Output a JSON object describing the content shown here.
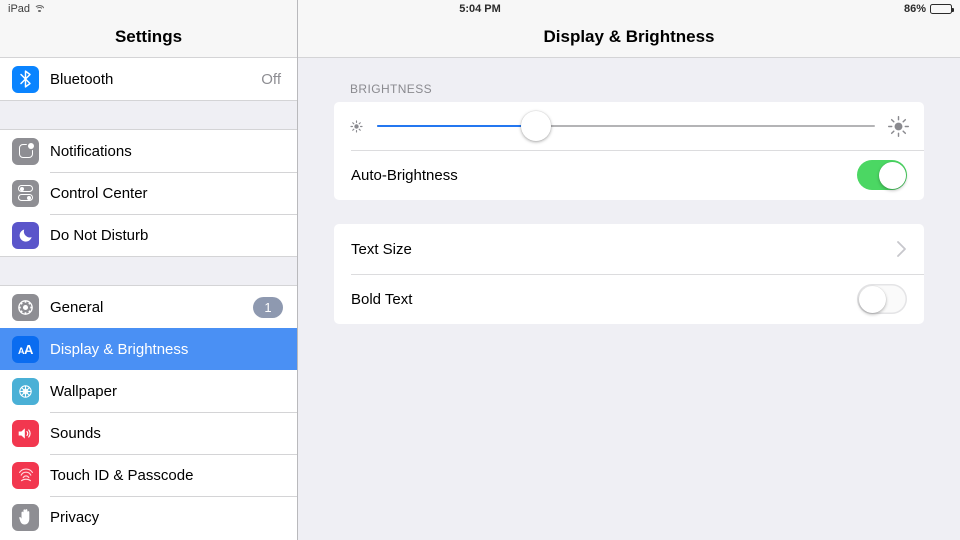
{
  "statusbar": {
    "device_label": "iPad",
    "wifi_icon": "wifi-icon",
    "time": "5:04 PM",
    "battery_percent": "86%",
    "battery_icon": "battery-icon"
  },
  "sidebar": {
    "title": "Settings",
    "groups": [
      {
        "items": [
          {
            "label": "Bluetooth",
            "value": "Off",
            "icon": "bluetooth-icon",
            "icon_color": "#0a84ff",
            "selected": false
          }
        ]
      },
      {
        "items": [
          {
            "label": "Notifications",
            "value": "",
            "icon": "notifications-icon",
            "icon_color": "#8e8e93",
            "selected": false
          },
          {
            "label": "Control Center",
            "value": "",
            "icon": "control-center-icon",
            "icon_color": "#8e8e93",
            "selected": false
          },
          {
            "label": "Do Not Disturb",
            "value": "",
            "icon": "moon-icon",
            "icon_color": "#5a55ca",
            "selected": false
          }
        ]
      },
      {
        "items": [
          {
            "label": "General",
            "value": "",
            "badge": "1",
            "icon": "gear-icon",
            "icon_color": "#8e8e93",
            "selected": false
          },
          {
            "label": "Display & Brightness",
            "value": "",
            "icon": "text-size-aa-icon",
            "icon_color": "#0a6cf0",
            "selected": true
          },
          {
            "label": "Wallpaper",
            "value": "",
            "icon": "flower-icon",
            "icon_color": "#4ab0d6",
            "selected": false
          },
          {
            "label": "Sounds",
            "value": "",
            "icon": "speaker-icon",
            "icon_color": "#f2374f",
            "selected": false
          },
          {
            "label": "Touch ID & Passcode",
            "value": "",
            "icon": "fingerprint-icon",
            "icon_color": "#f2374f",
            "selected": false
          },
          {
            "label": "Privacy",
            "value": "",
            "icon": "hand-icon",
            "icon_color": "#8e8e93",
            "selected": false
          }
        ]
      }
    ]
  },
  "content": {
    "title": "Display & Brightness",
    "brightness_section": {
      "header": "BRIGHTNESS",
      "slider": {
        "name": "brightness-slider",
        "value_percent": 32,
        "low_icon": "sun-small-icon",
        "high_icon": "sun-large-icon",
        "fill_color": "#2477f0",
        "track_color": "#b4b4b6"
      },
      "auto_brightness": {
        "label": "Auto-Brightness",
        "toggle_state": "on",
        "toggle_on_color": "#4bd763"
      }
    },
    "text_section": {
      "text_size": {
        "label": "Text Size",
        "chevron": "chevron-right-icon"
      },
      "bold_text": {
        "label": "Bold Text",
        "toggle_state": "off"
      }
    }
  }
}
